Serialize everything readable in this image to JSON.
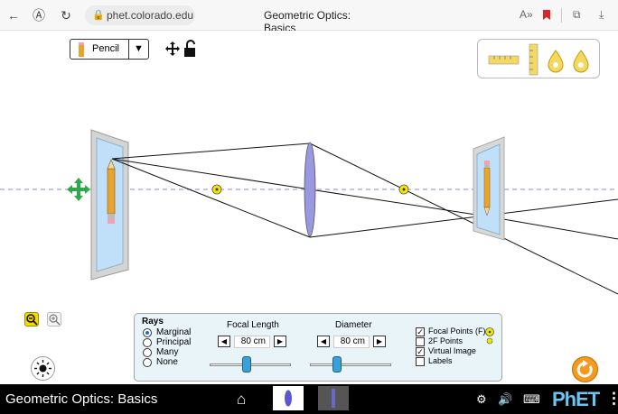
{
  "browser": {
    "back_icon": "←",
    "reader_icon": "Ⓐ",
    "refresh_icon": "↻",
    "lock_icon": "🔒",
    "url": "phet.colorado.edu",
    "tab_title": "Geometric Optics: Basics",
    "read_aloud_icon": "A»",
    "bookmark_icon": "bookmark",
    "collections_icon": "⧉",
    "download_icon": "⤓"
  },
  "sim": {
    "object_select": {
      "label": "Pencil",
      "arrow": "▼"
    },
    "move_icon": "✥",
    "lock_icon": "🔓",
    "colors": {
      "lens": "#9a98e0",
      "optic_axis": "#8a8ad0",
      "focal_point": "#f7e600",
      "image_frame": "#d8d8d8",
      "image_bg": "#bfe0f8"
    }
  },
  "panel": {
    "rays": {
      "title": "Rays",
      "options": [
        {
          "label": "Marginal",
          "selected": true
        },
        {
          "label": "Principal",
          "selected": false
        },
        {
          "label": "Many",
          "selected": false
        },
        {
          "label": "None",
          "selected": false
        }
      ]
    },
    "focal_length": {
      "title": "Focal Length",
      "value": "80 cm",
      "fraction": 0.45
    },
    "diameter": {
      "title": "Diameter",
      "value": "80 cm",
      "fraction": 0.33
    },
    "checkboxes": [
      {
        "label": "Focal Points (F)",
        "checked": true
      },
      {
        "label": "2F Points",
        "checked": false
      },
      {
        "label": "Virtual Image",
        "checked": true
      },
      {
        "label": "Labels",
        "checked": false
      }
    ],
    "check_mark": "✓",
    "step_left": "◀",
    "step_right": "▶"
  },
  "navbar": {
    "title": "Geometric Optics: Basics",
    "home_icon": "⌂",
    "settings_icon": "⚙",
    "sound_icon": "🔊",
    "keyboard_icon": "⌨",
    "phet": "PhET",
    "menu_icon": "⋮"
  }
}
